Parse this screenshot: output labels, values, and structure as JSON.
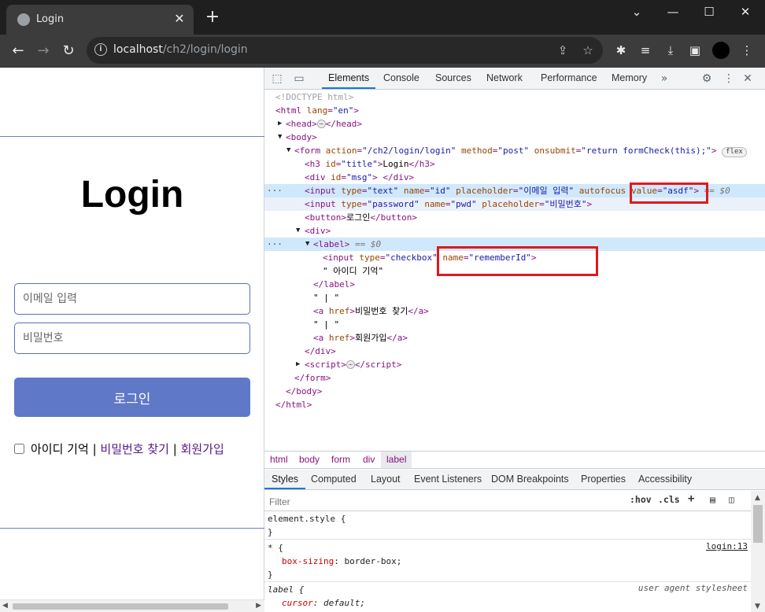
{
  "browser": {
    "tab_title": "Login",
    "url_host": "localhost",
    "url_path": "/ch2/login/login"
  },
  "page": {
    "title": "Login",
    "email_placeholder": "이메일 입력",
    "password_placeholder": "비밀번호",
    "login_button": "로그인",
    "remember_label": "아이디 기억",
    "separator": "|",
    "find_password": "비밀번호 찾기",
    "signup": "회원가입"
  },
  "devtools": {
    "tabs": [
      "Elements",
      "Console",
      "Sources",
      "Network",
      "Performance",
      "Memory"
    ],
    "active_tab": "Elements",
    "breadcrumbs": [
      "html",
      "body",
      "form",
      "div",
      "label"
    ],
    "styles_tabs": [
      "Styles",
      "Computed",
      "Layout",
      "Event Listeners",
      "DOM Breakpoints",
      "Properties",
      "Accessibility"
    ],
    "filter_placeholder": "Filter",
    "filter_hov": ":hov",
    "filter_cls": ".cls",
    "flex_badge": "flex",
    "eq0": "== $0",
    "rule_element_style": "element.style {",
    "rule_star_selector": "* {",
    "rule_star_prop": "box-sizing",
    "rule_star_value": "border-box;",
    "rule_star_source": "login:13",
    "rule_label_selector": "label {",
    "rule_label_prop": "cursor",
    "rule_label_value": "default;",
    "rule_label_source": "user agent stylesheet",
    "close_brace": "}"
  }
}
